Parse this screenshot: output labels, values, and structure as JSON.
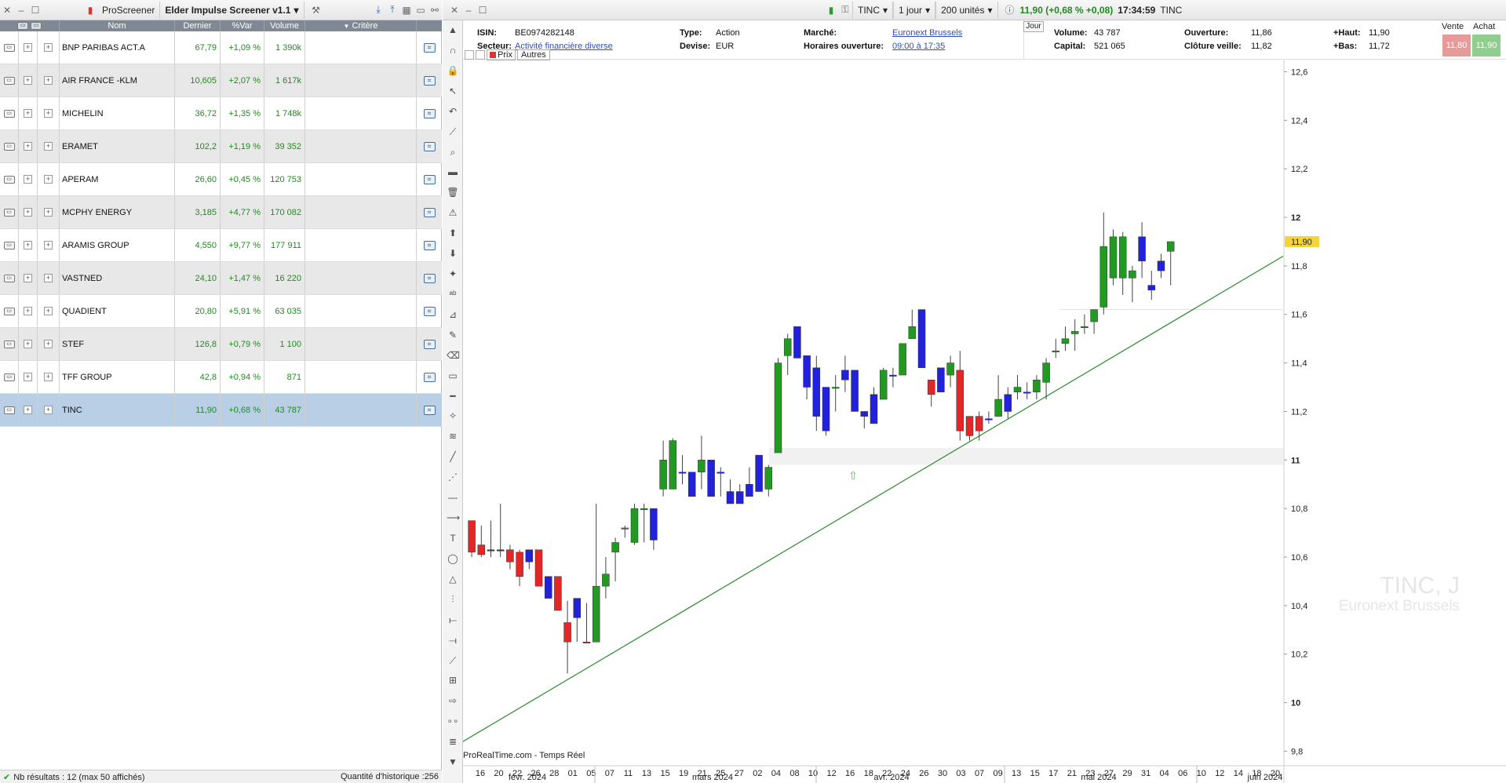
{
  "left": {
    "toolbar": {
      "app_label": "ProScreener",
      "screener_name": "Elder Impulse Screener v1.1"
    },
    "columns": {
      "name": "Nom",
      "last": "Dernier",
      "var": "%Var",
      "volume": "Volume",
      "criteria": "Critère"
    },
    "rows": [
      {
        "name": "BNP PARIBAS ACT.A",
        "last": "67,79",
        "var": "+1,09 %",
        "volume": "1 390k"
      },
      {
        "name": "AIR FRANCE -KLM",
        "last": "10,605",
        "var": "+2,07 %",
        "volume": "1 617k"
      },
      {
        "name": "MICHELIN",
        "last": "36,72",
        "var": "+1,35 %",
        "volume": "1 748k"
      },
      {
        "name": "ERAMET",
        "last": "102,2",
        "var": "+1,19 %",
        "volume": "39 352"
      },
      {
        "name": "APERAM",
        "last": "26,60",
        "var": "+0,45 %",
        "volume": "120 753"
      },
      {
        "name": "MCPHY ENERGY",
        "last": "3,185",
        "var": "+4,77 %",
        "volume": "170 082"
      },
      {
        "name": "ARAMIS GROUP",
        "last": "4,550",
        "var": "+9,77 %",
        "volume": "177 911"
      },
      {
        "name": "VASTNED",
        "last": "24,10",
        "var": "+1,47 %",
        "volume": "16 220"
      },
      {
        "name": "QUADIENT",
        "last": "20,80",
        "var": "+5,91 %",
        "volume": "63 035"
      },
      {
        "name": "STEF",
        "last": "126,8",
        "var": "+0,79 %",
        "volume": "1 100"
      },
      {
        "name": "TFF GROUP",
        "last": "42,8",
        "var": "+0,94 %",
        "volume": "871"
      },
      {
        "name": "TINC",
        "last": "11,90",
        "var": "+0,68 %",
        "volume": "43 787"
      }
    ],
    "status": {
      "results": "Nb résultats : 12 (max 50 affichés)",
      "history": "Quantité d'historique :256"
    }
  },
  "right": {
    "toolbar": {
      "ticker": "TINC",
      "period": "1 jour",
      "units": "200 unités",
      "quote": "11,90 (+0,68 % +0,08)",
      "time": "17:34:59",
      "ticker_label": "TINC"
    },
    "info": {
      "isin_lbl": "ISIN:",
      "isin": "BE0974282148",
      "sector_lbl": "Secteur:",
      "sector": "Activité financière diverse",
      "type_lbl": "Type:",
      "type": "Action",
      "currency_lbl": "Devise:",
      "currency": "EUR",
      "market_lbl": "Marché:",
      "market": "Euronext Brussels",
      "hours_lbl": "Horaires ouverture:",
      "hours": "09:00 à 17:35",
      "jour_tab": "Jour",
      "volume_lbl": "Volume:",
      "volume": "43 787",
      "capital_lbl": "Capital:",
      "capital": "521 065",
      "open_lbl": "Ouverture:",
      "open": "11,86",
      "prev_close_lbl": "Clôture veille:",
      "prev_close": "11,82",
      "high_lbl": "+Haut:",
      "high": "11,90",
      "low_lbl": "+Bas:",
      "low": "11,72",
      "vente_lbl": "Vente",
      "vente": "11,80",
      "achat_lbl": "Achat",
      "achat": "11,90"
    },
    "chart_tabs": {
      "price": "Prix",
      "others": "Autres"
    },
    "footer": {
      "source": "ProRealTime.com - Temps Réel"
    },
    "watermark": {
      "ticker": "TINC, J",
      "market": "Euronext Brussels"
    },
    "colors": {
      "up": "#229922",
      "down": "#e32626",
      "neutral": "#2222dd",
      "trend": "#2a8a2a",
      "last_price_bg": "#f5d33a"
    }
  },
  "chart_data": {
    "type": "candlestick",
    "ylim": [
      9.74,
      12.65
    ],
    "y_ticks": [
      9.8,
      10,
      10.2,
      10.4,
      10.6,
      10.8,
      11,
      11.2,
      11.4,
      11.6,
      11.8,
      12,
      12.2,
      12.4,
      12.6
    ],
    "y_tick_labels": [
      "9,8",
      "10",
      "10,2",
      "10,4",
      "10,6",
      "10,8",
      "11",
      "11,2",
      "11,4",
      "11,6",
      "11,8",
      "12",
      "12,2",
      "12,4",
      "12,6"
    ],
    "last_price": "11,90",
    "x_ticks": [
      "16",
      "20",
      "22",
      "26",
      "28",
      "01",
      "05",
      "07",
      "11",
      "13",
      "15",
      "19",
      "21",
      "25",
      "27",
      "02",
      "04",
      "08",
      "10",
      "12",
      "16",
      "18",
      "22",
      "24",
      "26",
      "30",
      "03",
      "07",
      "09",
      "13",
      "15",
      "17",
      "21",
      "23",
      "27",
      "29",
      "31",
      "04",
      "06",
      "10",
      "12",
      "14",
      "18",
      "20"
    ],
    "month_labels": [
      "févr. 2024",
      "mars 2024",
      "avr. 2024",
      "mai 2024",
      "juin 2024"
    ],
    "candles": [
      {
        "o": 10.75,
        "h": 10.75,
        "l": 10.6,
        "c": 10.62,
        "k": "d"
      },
      {
        "o": 10.65,
        "h": 10.73,
        "l": 10.6,
        "c": 10.61,
        "k": "d"
      },
      {
        "o": 10.63,
        "h": 10.75,
        "l": 10.6,
        "c": 10.63,
        "k": "n"
      },
      {
        "o": 10.63,
        "h": 10.82,
        "l": 10.6,
        "c": 10.63,
        "k": "n"
      },
      {
        "o": 10.63,
        "h": 10.65,
        "l": 10.55,
        "c": 10.58,
        "k": "d"
      },
      {
        "o": 10.62,
        "h": 10.63,
        "l": 10.48,
        "c": 10.52,
        "k": "d"
      },
      {
        "o": 10.58,
        "h": 10.63,
        "l": 10.55,
        "c": 10.63,
        "k": "n"
      },
      {
        "o": 10.63,
        "h": 10.63,
        "l": 10.48,
        "c": 10.48,
        "k": "d"
      },
      {
        "o": 10.52,
        "h": 10.52,
        "l": 10.43,
        "c": 10.43,
        "k": "n"
      },
      {
        "o": 10.52,
        "h": 10.52,
        "l": 10.38,
        "c": 10.38,
        "k": "d"
      },
      {
        "o": 10.33,
        "h": 10.42,
        "l": 10.12,
        "c": 10.25,
        "k": "d"
      },
      {
        "o": 10.35,
        "h": 10.43,
        "l": 10.25,
        "c": 10.43,
        "k": "n"
      },
      {
        "o": 10.25,
        "h": 10.41,
        "l": 10.25,
        "c": 10.25,
        "k": "d"
      },
      {
        "o": 10.25,
        "h": 10.82,
        "l": 10.25,
        "c": 10.48,
        "k": "u"
      },
      {
        "o": 10.48,
        "h": 10.6,
        "l": 10.43,
        "c": 10.53,
        "k": "u"
      },
      {
        "o": 10.62,
        "h": 10.68,
        "l": 10.5,
        "c": 10.66,
        "k": "u"
      },
      {
        "o": 10.72,
        "h": 10.73,
        "l": 10.68,
        "c": 10.72,
        "k": "u"
      },
      {
        "o": 10.66,
        "h": 10.82,
        "l": 10.65,
        "c": 10.8,
        "k": "u"
      },
      {
        "o": 10.8,
        "h": 10.82,
        "l": 10.66,
        "c": 10.8,
        "k": "u"
      },
      {
        "o": 10.8,
        "h": 10.8,
        "l": 10.63,
        "c": 10.67,
        "k": "n"
      },
      {
        "o": 10.88,
        "h": 11.08,
        "l": 10.85,
        "c": 11.0,
        "k": "u"
      },
      {
        "o": 10.88,
        "h": 11.09,
        "l": 10.88,
        "c": 11.08,
        "k": "u"
      },
      {
        "o": 10.95,
        "h": 11.02,
        "l": 10.9,
        "c": 10.95,
        "k": "n"
      },
      {
        "o": 10.95,
        "h": 10.95,
        "l": 10.85,
        "c": 10.85,
        "k": "n"
      },
      {
        "o": 10.95,
        "h": 11.1,
        "l": 10.88,
        "c": 11.0,
        "k": "u"
      },
      {
        "o": 11.0,
        "h": 11.0,
        "l": 10.85,
        "c": 10.85,
        "k": "n"
      },
      {
        "o": 10.95,
        "h": 10.97,
        "l": 10.85,
        "c": 10.95,
        "k": "n"
      },
      {
        "o": 10.87,
        "h": 10.92,
        "l": 10.82,
        "c": 10.82,
        "k": "n"
      },
      {
        "o": 10.87,
        "h": 10.9,
        "l": 10.82,
        "c": 10.82,
        "k": "n"
      },
      {
        "o": 10.9,
        "h": 10.97,
        "l": 10.85,
        "c": 10.85,
        "k": "n"
      },
      {
        "o": 11.02,
        "h": 11.02,
        "l": 10.87,
        "c": 10.87,
        "k": "n"
      },
      {
        "o": 10.88,
        "h": 10.98,
        "l": 10.85,
        "c": 10.97,
        "k": "u"
      },
      {
        "o": 11.03,
        "h": 11.42,
        "l": 11.03,
        "c": 11.4,
        "k": "u"
      },
      {
        "o": 11.43,
        "h": 11.52,
        "l": 11.35,
        "c": 11.5,
        "k": "u"
      },
      {
        "o": 11.55,
        "h": 11.55,
        "l": 11.42,
        "c": 11.42,
        "k": "n"
      },
      {
        "o": 11.43,
        "h": 11.43,
        "l": 11.25,
        "c": 11.3,
        "k": "n"
      },
      {
        "o": 11.38,
        "h": 11.43,
        "l": 11.12,
        "c": 11.18,
        "k": "n"
      },
      {
        "o": 11.3,
        "h": 11.3,
        "l": 11.1,
        "c": 11.12,
        "k": "n"
      },
      {
        "o": 11.3,
        "h": 11.35,
        "l": 11.2,
        "c": 11.3,
        "k": "u"
      },
      {
        "o": 11.37,
        "h": 11.43,
        "l": 11.28,
        "c": 11.33,
        "k": "n"
      },
      {
        "o": 11.37,
        "h": 11.37,
        "l": 11.2,
        "c": 11.2,
        "k": "n"
      },
      {
        "o": 11.18,
        "h": 11.2,
        "l": 11.13,
        "c": 11.2,
        "k": "n"
      },
      {
        "o": 11.15,
        "h": 11.3,
        "l": 11.15,
        "c": 11.27,
        "k": "n"
      },
      {
        "o": 11.25,
        "h": 11.38,
        "l": 11.25,
        "c": 11.37,
        "k": "u"
      },
      {
        "o": 11.35,
        "h": 11.38,
        "l": 11.3,
        "c": 11.35,
        "k": "n"
      },
      {
        "o": 11.35,
        "h": 11.48,
        "l": 11.35,
        "c": 11.48,
        "k": "u"
      },
      {
        "o": 11.5,
        "h": 11.62,
        "l": 11.5,
        "c": 11.55,
        "k": "u"
      },
      {
        "o": 11.62,
        "h": 11.62,
        "l": 11.38,
        "c": 11.38,
        "k": "n"
      },
      {
        "o": 11.33,
        "h": 11.33,
        "l": 11.22,
        "c": 11.27,
        "k": "d"
      },
      {
        "o": 11.28,
        "h": 11.38,
        "l": 11.28,
        "c": 11.38,
        "k": "n"
      },
      {
        "o": 11.4,
        "h": 11.43,
        "l": 11.3,
        "c": 11.35,
        "k": "u"
      },
      {
        "o": 11.37,
        "h": 11.45,
        "l": 11.08,
        "c": 11.12,
        "k": "d"
      },
      {
        "o": 11.18,
        "h": 11.18,
        "l": 11.08,
        "c": 11.1,
        "k": "d"
      },
      {
        "o": 11.18,
        "h": 11.2,
        "l": 11.08,
        "c": 11.12,
        "k": "d"
      },
      {
        "o": 11.17,
        "h": 11.2,
        "l": 11.15,
        "c": 11.17,
        "k": "n"
      },
      {
        "o": 11.18,
        "h": 11.35,
        "l": 11.18,
        "c": 11.25,
        "k": "u"
      },
      {
        "o": 11.27,
        "h": 11.3,
        "l": 11.17,
        "c": 11.2,
        "k": "n"
      },
      {
        "o": 11.28,
        "h": 11.35,
        "l": 11.25,
        "c": 11.3,
        "k": "u"
      },
      {
        "o": 11.28,
        "h": 11.32,
        "l": 11.25,
        "c": 11.28,
        "k": "n"
      },
      {
        "o": 11.28,
        "h": 11.35,
        "l": 11.25,
        "c": 11.33,
        "k": "u"
      },
      {
        "o": 11.32,
        "h": 11.42,
        "l": 11.25,
        "c": 11.4,
        "k": "u"
      },
      {
        "o": 11.45,
        "h": 11.5,
        "l": 11.42,
        "c": 11.45,
        "k": "u"
      },
      {
        "o": 11.48,
        "h": 11.55,
        "l": 11.45,
        "c": 11.5,
        "k": "u"
      },
      {
        "o": 11.52,
        "h": 11.58,
        "l": 11.45,
        "c": 11.53,
        "k": "u"
      },
      {
        "o": 11.55,
        "h": 11.6,
        "l": 11.52,
        "c": 11.55,
        "k": "u"
      },
      {
        "o": 11.62,
        "h": 11.6,
        "l": 11.52,
        "c": 11.57,
        "k": "u"
      },
      {
        "o": 11.63,
        "h": 12.02,
        "l": 11.6,
        "c": 11.88,
        "k": "u"
      },
      {
        "o": 11.75,
        "h": 11.95,
        "l": 11.72,
        "c": 11.92,
        "k": "u"
      },
      {
        "o": 11.92,
        "h": 11.94,
        "l": 11.68,
        "c": 11.75,
        "k": "u"
      },
      {
        "o": 11.75,
        "h": 11.8,
        "l": 11.65,
        "c": 11.78,
        "k": "u"
      },
      {
        "o": 11.82,
        "h": 11.98,
        "l": 11.75,
        "c": 11.92,
        "k": "n"
      },
      {
        "o": 11.72,
        "h": 11.78,
        "l": 11.66,
        "c": 11.7,
        "k": "n"
      },
      {
        "o": 11.82,
        "h": 11.85,
        "l": 11.75,
        "c": 11.78,
        "k": "n"
      },
      {
        "o": 11.86,
        "h": 11.9,
        "l": 11.72,
        "c": 11.9,
        "k": "u"
      }
    ]
  }
}
